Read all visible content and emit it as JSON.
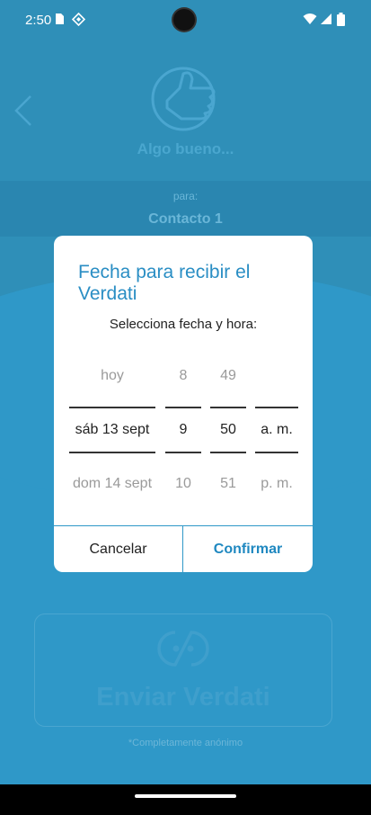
{
  "status_bar": {
    "time": "2:50"
  },
  "background": {
    "subject": "Algo bueno...",
    "para_label": "para:",
    "contact": "Contacto 1",
    "send_button": "Enviar Verdati",
    "anonymous_note": "*Completamente anónimo"
  },
  "dialog": {
    "title": "Fecha para recibir el Verdati",
    "subtitle": "Selecciona fecha y hora:",
    "date_picker": {
      "prev": "hoy",
      "selected": "sáb 13 sept",
      "next": "dom 14 sept"
    },
    "hour_picker": {
      "prev": "8",
      "selected": "9",
      "next": "10"
    },
    "minute_picker": {
      "prev": "49",
      "selected": "50",
      "next": "51"
    },
    "ampm_picker": {
      "prev": "",
      "selected": "a. m.",
      "next": "p. m."
    },
    "cancel_label": "Cancelar",
    "confirm_label": "Confirmar"
  },
  "colors": {
    "accent": "#2a8ec4",
    "background": "#2f98c8",
    "dialog_bg": "#ffffff"
  }
}
